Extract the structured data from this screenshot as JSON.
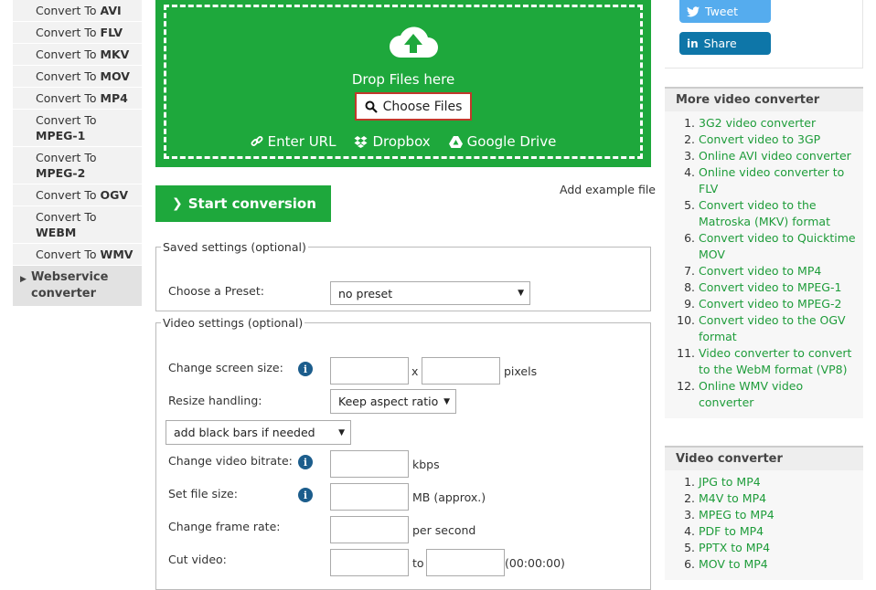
{
  "left_nav": {
    "items": [
      {
        "prefix": "Convert To",
        "bold": "AVI"
      },
      {
        "prefix": "Convert To",
        "bold": "FLV"
      },
      {
        "prefix": "Convert To",
        "bold": "MKV"
      },
      {
        "prefix": "Convert To",
        "bold": "MOV"
      },
      {
        "prefix": "Convert To",
        "bold": "MP4"
      },
      {
        "prefix": "Convert To",
        "bold": "MPEG-1"
      },
      {
        "prefix": "Convert To",
        "bold": "MPEG-2"
      },
      {
        "prefix": "Convert To",
        "bold": "OGV"
      },
      {
        "prefix": "Convert To",
        "bold": "WEBM"
      },
      {
        "prefix": "Convert To",
        "bold": "WMV"
      }
    ],
    "webservice": "Webservice converter"
  },
  "upload": {
    "drop_text": "Drop Files here",
    "choose_label": "Choose Files",
    "enter_url": "Enter URL",
    "dropbox": "Dropbox",
    "google_drive": "Google Drive"
  },
  "start_label": "Start conversion",
  "add_example": "Add example file",
  "saved_settings": {
    "legend": "Saved settings (optional)",
    "preset_label": "Choose a Preset:",
    "preset_value": "no preset"
  },
  "video_settings": {
    "legend": "Video settings (optional)",
    "screen_size_label": "Change screen size:",
    "x": "x",
    "pixels": "pixels",
    "resize_label": "Resize handling:",
    "resize_value": "Keep aspect ratio",
    "black_bars_value": "add black bars if needed",
    "bitrate_label": "Change video bitrate:",
    "bitrate_unit": "kbps",
    "file_size_label": "Set file size:",
    "file_size_unit": "MB (approx.)",
    "frame_rate_label": "Change frame rate:",
    "frame_rate_unit": "per second",
    "cut_label": "Cut video:",
    "to": "to",
    "time_hint": "(00:00:00)"
  },
  "social": {
    "tweet": "Tweet",
    "share": "Share"
  },
  "more_video": {
    "title": "More video converter",
    "items": [
      "3G2 video converter",
      "Convert video to 3GP",
      "Online AVI video converter",
      "Online video converter to FLV",
      "Convert video to the Matroska (MKV) format",
      "Convert video to Quicktime MOV",
      "Convert video to MP4",
      "Convert video to MPEG-1",
      "Convert video to MPEG-2",
      "Convert video to the OGV format",
      "Video converter to convert to the WebM format (VP8)",
      "Online WMV video converter"
    ]
  },
  "video_converter": {
    "title": "Video converter",
    "items": [
      "JPG to MP4",
      "M4V to MP4",
      "MPEG to MP4",
      "PDF to MP4",
      "PPTX to MP4",
      "MOV to MP4"
    ]
  },
  "colors": {
    "green": "#1ea83c",
    "tweet": "#55acee",
    "share": "#0e76a8",
    "link": "#1e9c3a"
  }
}
